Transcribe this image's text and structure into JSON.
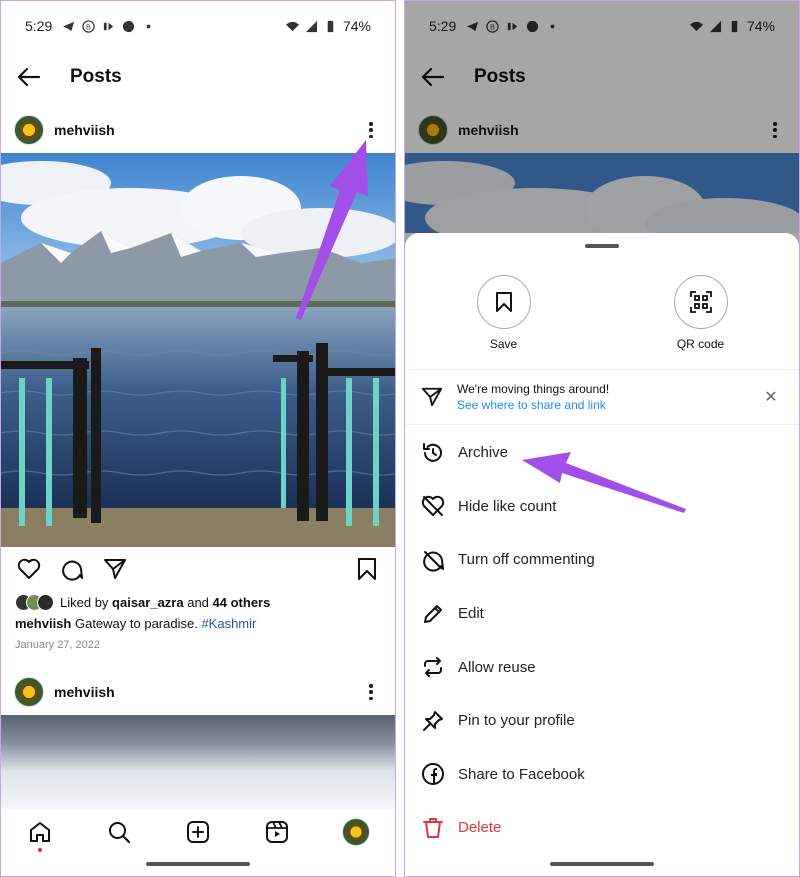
{
  "status_bar": {
    "time": "5:29",
    "battery": "74%"
  },
  "header": {
    "title": "Posts"
  },
  "post": {
    "username": "mehviish",
    "likes_prefix": "Liked by ",
    "likes_user": "qaisar_azra",
    "likes_and": " and ",
    "likes_others": "44 others",
    "caption_user": "mehviish",
    "caption_text": " Gateway to paradise. ",
    "hashtag": "#Kashmir",
    "date": "January 27, 2022"
  },
  "post2": {
    "username": "mehviish"
  },
  "sheet": {
    "save_label": "Save",
    "qr_label": "QR code",
    "notice_title": "We're moving things around!",
    "notice_link": "See where to share and link",
    "menu": [
      {
        "icon": "archive-icon",
        "label": "Archive"
      },
      {
        "icon": "hide-like-icon",
        "label": "Hide like count"
      },
      {
        "icon": "comment-off-icon",
        "label": "Turn off commenting"
      },
      {
        "icon": "pencil-icon",
        "label": "Edit"
      },
      {
        "icon": "reuse-icon",
        "label": "Allow reuse"
      },
      {
        "icon": "pin-icon",
        "label": "Pin to your profile"
      },
      {
        "icon": "facebook-icon",
        "label": "Share to Facebook"
      },
      {
        "icon": "trash-icon",
        "label": "Delete"
      }
    ]
  },
  "colors": {
    "annotation_arrow": "#a24ee8",
    "delete": "#e5343d",
    "link": "#1a8ff0",
    "hashtag": "#1a5a9a"
  }
}
